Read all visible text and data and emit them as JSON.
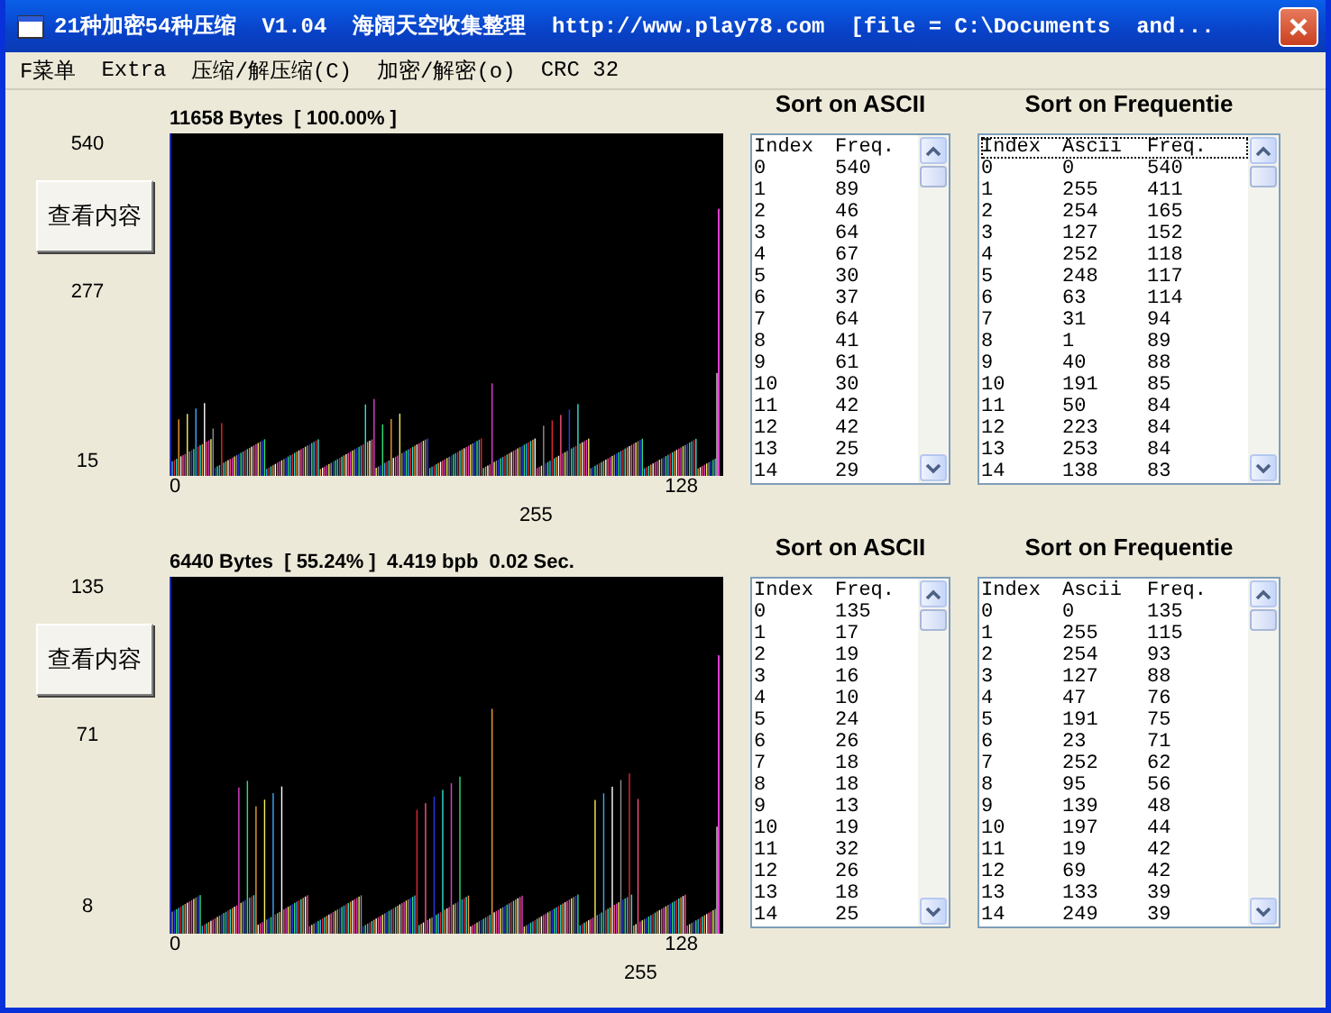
{
  "window": {
    "title": "21种加密54种压缩  V1.04  海阔天空收集整理  http://www.play78.com  [file = C:\\Documents  and..."
  },
  "menu": [
    {
      "label": "F菜单"
    },
    {
      "label": "Extra"
    },
    {
      "label": "压缩/解压缩(C)"
    },
    {
      "label": "加密/解密(o)"
    },
    {
      "label": "CRC 32"
    }
  ],
  "panels": [
    {
      "caption": "11658 Bytes  [ 100.00% ]",
      "y_labels": [
        "540",
        "277",
        "15"
      ],
      "button": "查看内容",
      "x_labels": [
        "0",
        "128",
        "255"
      ],
      "lists": [
        {
          "title": "Sort on ASCII",
          "focused": false,
          "columns": [
            "Index",
            "Freq."
          ],
          "rows": [
            [
              "0",
              "540"
            ],
            [
              "1",
              "89"
            ],
            [
              "2",
              "46"
            ],
            [
              "3",
              "64"
            ],
            [
              "4",
              "67"
            ],
            [
              "5",
              "30"
            ],
            [
              "6",
              "37"
            ],
            [
              "7",
              "64"
            ],
            [
              "8",
              "41"
            ],
            [
              "9",
              "61"
            ],
            [
              "10",
              "30"
            ],
            [
              "11",
              "42"
            ],
            [
              "12",
              "42"
            ],
            [
              "13",
              "25"
            ],
            [
              "14",
              "29"
            ]
          ]
        },
        {
          "title": "Sort on Frequentie",
          "focused": true,
          "columns": [
            "Index",
            "Ascii",
            "Freq."
          ],
          "rows": [
            [
              "0",
              "0",
              "540"
            ],
            [
              "1",
              "255",
              "411"
            ],
            [
              "2",
              "254",
              "165"
            ],
            [
              "3",
              "127",
              "152"
            ],
            [
              "4",
              "252",
              "118"
            ],
            [
              "5",
              "248",
              "117"
            ],
            [
              "6",
              "63",
              "114"
            ],
            [
              "7",
              "31",
              "94"
            ],
            [
              "8",
              "1",
              "89"
            ],
            [
              "9",
              "40",
              "88"
            ],
            [
              "10",
              "191",
              "85"
            ],
            [
              "11",
              "50",
              "84"
            ],
            [
              "12",
              "223",
              "84"
            ],
            [
              "13",
              "253",
              "84"
            ],
            [
              "14",
              "138",
              "83"
            ]
          ]
        }
      ]
    },
    {
      "caption": "6440 Bytes  [ 55.24% ]  4.419 bpb  0.02 Sec.",
      "y_labels": [
        "135",
        "71",
        "8"
      ],
      "button": "查看内容",
      "x_labels": [
        "0",
        "128",
        "255"
      ],
      "lists": [
        {
          "title": "Sort on ASCII",
          "focused": false,
          "columns": [
            "Index",
            "Freq."
          ],
          "rows": [
            [
              "0",
              "135"
            ],
            [
              "1",
              "17"
            ],
            [
              "2",
              "19"
            ],
            [
              "3",
              "16"
            ],
            [
              "4",
              "10"
            ],
            [
              "5",
              "24"
            ],
            [
              "6",
              "26"
            ],
            [
              "7",
              "18"
            ],
            [
              "8",
              "18"
            ],
            [
              "9",
              "13"
            ],
            [
              "10",
              "19"
            ],
            [
              "11",
              "32"
            ],
            [
              "12",
              "26"
            ],
            [
              "13",
              "18"
            ],
            [
              "14",
              "25"
            ]
          ]
        },
        {
          "title": "Sort on Frequentie",
          "focused": false,
          "columns": [
            "Index",
            "Ascii",
            "Freq."
          ],
          "rows": [
            [
              "0",
              "0",
              "135"
            ],
            [
              "1",
              "255",
              "115"
            ],
            [
              "2",
              "254",
              "93"
            ],
            [
              "3",
              "127",
              "88"
            ],
            [
              "4",
              "47",
              "76"
            ],
            [
              "5",
              "191",
              "75"
            ],
            [
              "6",
              "23",
              "71"
            ],
            [
              "7",
              "252",
              "62"
            ],
            [
              "8",
              "95",
              "56"
            ],
            [
              "9",
              "139",
              "48"
            ],
            [
              "10",
              "197",
              "44"
            ],
            [
              "11",
              "19",
              "42"
            ],
            [
              "12",
              "69",
              "42"
            ],
            [
              "13",
              "133",
              "39"
            ],
            [
              "14",
              "249",
              "39"
            ]
          ]
        }
      ]
    }
  ]
}
